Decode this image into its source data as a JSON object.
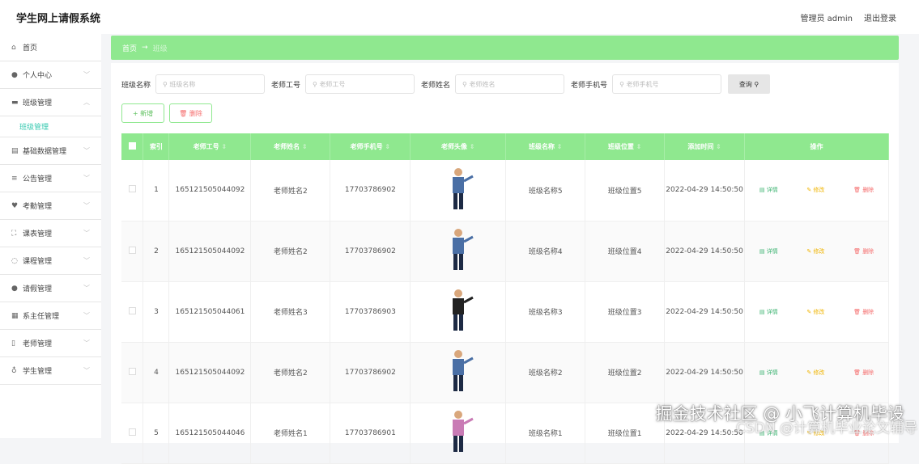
{
  "header": {
    "title": "学生网上请假系统",
    "user": "管理员 admin",
    "logout": "退出登录"
  },
  "sidebar": {
    "items": [
      {
        "label": "首页",
        "icon": "home-icon",
        "glyph": "⌂",
        "chev": false
      },
      {
        "label": "个人中心",
        "icon": "user-icon",
        "glyph": "●",
        "chev": true
      },
      {
        "label": "班级管理",
        "icon": "class-icon",
        "glyph": "▬",
        "chev": true,
        "open": true
      },
      {
        "label": "基础数据管理",
        "icon": "database-icon",
        "glyph": "▤",
        "chev": true
      },
      {
        "label": "公告管理",
        "icon": "list-icon",
        "glyph": "≡",
        "chev": true
      },
      {
        "label": "考勤管理",
        "icon": "trophy-icon",
        "glyph": "♥",
        "chev": true
      },
      {
        "label": "课表管理",
        "icon": "frame-icon",
        "glyph": "⛶",
        "chev": true
      },
      {
        "label": "课程管理",
        "icon": "power-icon",
        "glyph": "◌",
        "chev": true
      },
      {
        "label": "请假管理",
        "icon": "user-icon",
        "glyph": "●",
        "chev": true
      },
      {
        "label": "系主任管理",
        "icon": "grid-icon",
        "glyph": "▦",
        "chev": true
      },
      {
        "label": "老师管理",
        "icon": "phone-icon",
        "glyph": "▯",
        "chev": true
      },
      {
        "label": "学生管理",
        "icon": "mic-icon",
        "glyph": "♁",
        "chev": true
      }
    ],
    "sub": "班级管理"
  },
  "breadcrumb": {
    "home": "首页",
    "arrow": "→",
    "current": "班级"
  },
  "search": {
    "fields": [
      {
        "label": "班级名称",
        "placeholder": "班级名称"
      },
      {
        "label": "老师工号",
        "placeholder": "老师工号"
      },
      {
        "label": "老师姓名",
        "placeholder": "老师姓名"
      },
      {
        "label": "老师手机号",
        "placeholder": "老师手机号"
      }
    ],
    "button": "查询"
  },
  "actions": {
    "add": "+ 新增",
    "delete": "删除"
  },
  "table": {
    "headers": [
      "索引",
      "老师工号",
      "老师姓名",
      "老师手机号",
      "老师头像",
      "班级名称",
      "班级位置",
      "添加时间",
      "操作"
    ],
    "row_actions": {
      "detail": "详情",
      "edit": "修改",
      "delete": "删除"
    },
    "rows": [
      {
        "index": "1",
        "id": "165121505044092",
        "name": "老师姓名2",
        "phone": "17703786902",
        "class": "班级名称5",
        "location": "班级位置5",
        "time": "2022-04-29 14:50:50"
      },
      {
        "index": "2",
        "id": "165121505044092",
        "name": "老师姓名2",
        "phone": "17703786902",
        "class": "班级名称4",
        "location": "班级位置4",
        "time": "2022-04-29 14:50:50"
      },
      {
        "index": "3",
        "id": "165121505044061",
        "name": "老师姓名3",
        "phone": "17703786903",
        "class": "班级名称3",
        "location": "班级位置3",
        "time": "2022-04-29 14:50:50"
      },
      {
        "index": "4",
        "id": "165121505044092",
        "name": "老师姓名2",
        "phone": "17703786902",
        "class": "班级名称2",
        "location": "班级位置2",
        "time": "2022-04-29 14:50:50"
      },
      {
        "index": "5",
        "id": "165121505044046",
        "name": "老师姓名1",
        "phone": "17703786901",
        "class": "班级名称1",
        "location": "班级位置1",
        "time": "2022-04-29 14:50:50"
      }
    ]
  },
  "watermark": {
    "line1": "掘金技术社区 @ 小飞计算机毕设",
    "line2": "CSDN @计算机毕业论文辅导"
  },
  "colors": {
    "accent": "#8fe88f",
    "teal": "#36c9b0",
    "detail": "#3cb371",
    "edit": "#f0b400",
    "delete": "#f56c6c"
  }
}
